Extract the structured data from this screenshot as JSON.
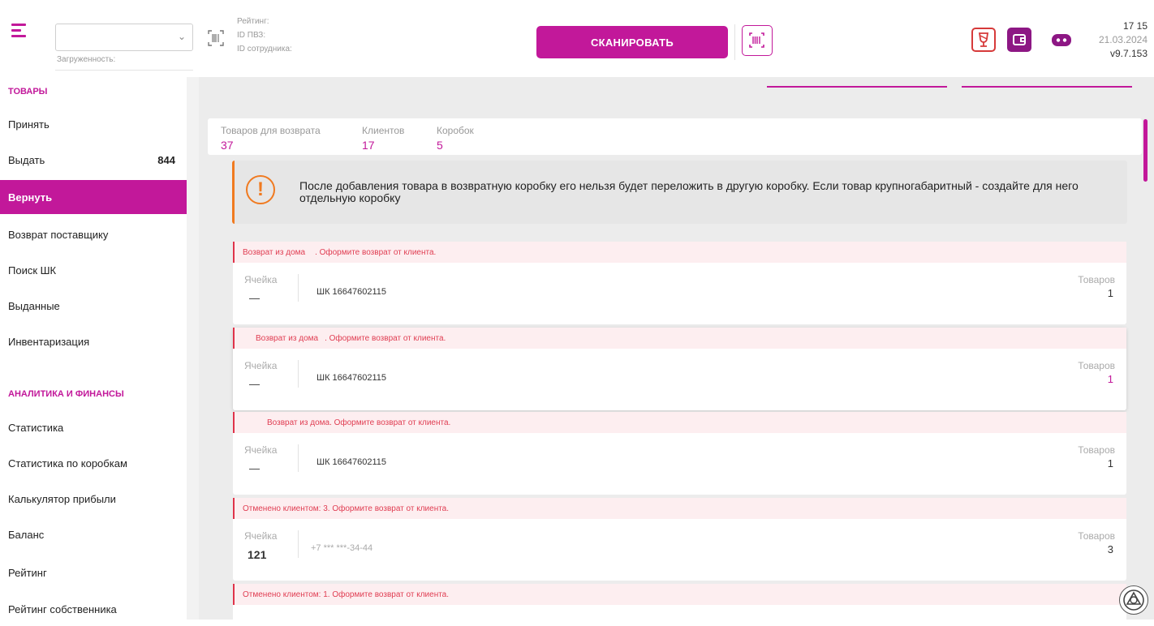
{
  "header": {
    "load_label": "Загруженность:",
    "info_lines": [
      "Рейтинг:",
      "ID ПВЗ:",
      "ID сотрудника:"
    ],
    "scan_label": "СКАНИРОВАТЬ",
    "time": "17 15",
    "date": "21.03.2024",
    "version": "v9.7.153"
  },
  "sidebar": {
    "section_goods": "ТОВАРЫ",
    "section_analytics": "АНАЛИТИКА И ФИНАНСЫ",
    "items": [
      {
        "label": "Принять"
      },
      {
        "label": "Выдать",
        "count": "844"
      },
      {
        "label": "Вернуть",
        "active": true
      },
      {
        "label": "Возврат поставщику"
      },
      {
        "label": "Поиск ШК"
      },
      {
        "label": "Выданные"
      },
      {
        "label": "Инвентаризация"
      }
    ],
    "analytics_items": [
      {
        "label": "Статистика"
      },
      {
        "label": "Статистика по коробкам"
      },
      {
        "label": "Калькулятор прибыли"
      },
      {
        "label": "Баланс"
      },
      {
        "label": "Рейтинг"
      },
      {
        "label": "Рейтинг собственника"
      }
    ]
  },
  "summary": {
    "returns_label": "Товаров для возврата",
    "returns_value": "37",
    "clients_label": "Клиентов",
    "clients_value": "17",
    "boxes_label": "Коробок",
    "boxes_value": "5"
  },
  "warning": {
    "text": "После добавления товара в возвратную коробку его нельзя будет переложить в другую коробку. Если товар крупногабаритный - создайте для него отдельную коробку"
  },
  "cards": [
    {
      "head_a": "Возврат из дома",
      "head_b": ". Оформите возврат от клиента.",
      "cell_label": "Ячейка",
      "cell_value": "—",
      "id_text": "ШК 16647602115",
      "goods_label": "Товаров",
      "goods_value": "1"
    },
    {
      "head_a": "Возврат из дома",
      "head_b": ". Оформите возврат от клиента.",
      "cell_label": "Ячейка",
      "cell_value": "—",
      "id_text": "ШК 16647602115",
      "goods_label": "Товаров",
      "goods_value": "1"
    },
    {
      "head_a": "Возврат из дома",
      "head_b": ". Оформите возврат от клиента.",
      "cell_label": "Ячейка",
      "cell_value": "—",
      "id_text": "ШК 16647602115",
      "goods_label": "Товаров",
      "goods_value": "1"
    },
    {
      "head_a": "Отменено клиентом: 3. Оформите возврат от клиента.",
      "cell_label": "Ячейка",
      "cell_value": "121",
      "phone": "+7 *** ***-34-44",
      "goods_label": "Товаров",
      "goods_value": "3"
    },
    {
      "head_a": "Отменено клиентом: 1. Оформите возврат от клиента."
    }
  ]
}
